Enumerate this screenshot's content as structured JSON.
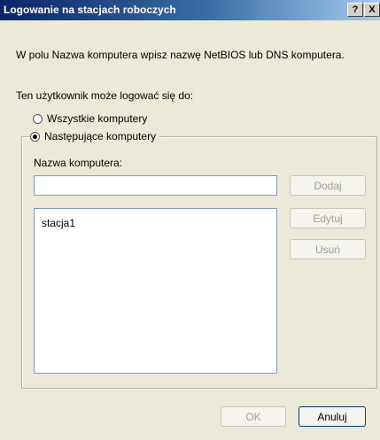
{
  "window": {
    "title": "Logowanie na stacjach roboczych",
    "help_label": "?",
    "close_label": "X"
  },
  "instruction": "W polu Nazwa komputera wpisz nazwę NetBIOS lub DNS komputera.",
  "logon_label": "Ten użytkownik może logować się do:",
  "radio_all": {
    "label": "Wszystkie komputery",
    "checked": false
  },
  "radio_following": {
    "label": "Następujące komputery",
    "checked": true
  },
  "computer_name_label": "Nazwa komputera:",
  "computer_name_input": {
    "value": ""
  },
  "computers_list": [
    "stacja1"
  ],
  "buttons": {
    "add": "Dodaj",
    "edit": "Edytuj",
    "remove": "Usuń",
    "ok": "OK",
    "cancel": "Anuluj"
  }
}
